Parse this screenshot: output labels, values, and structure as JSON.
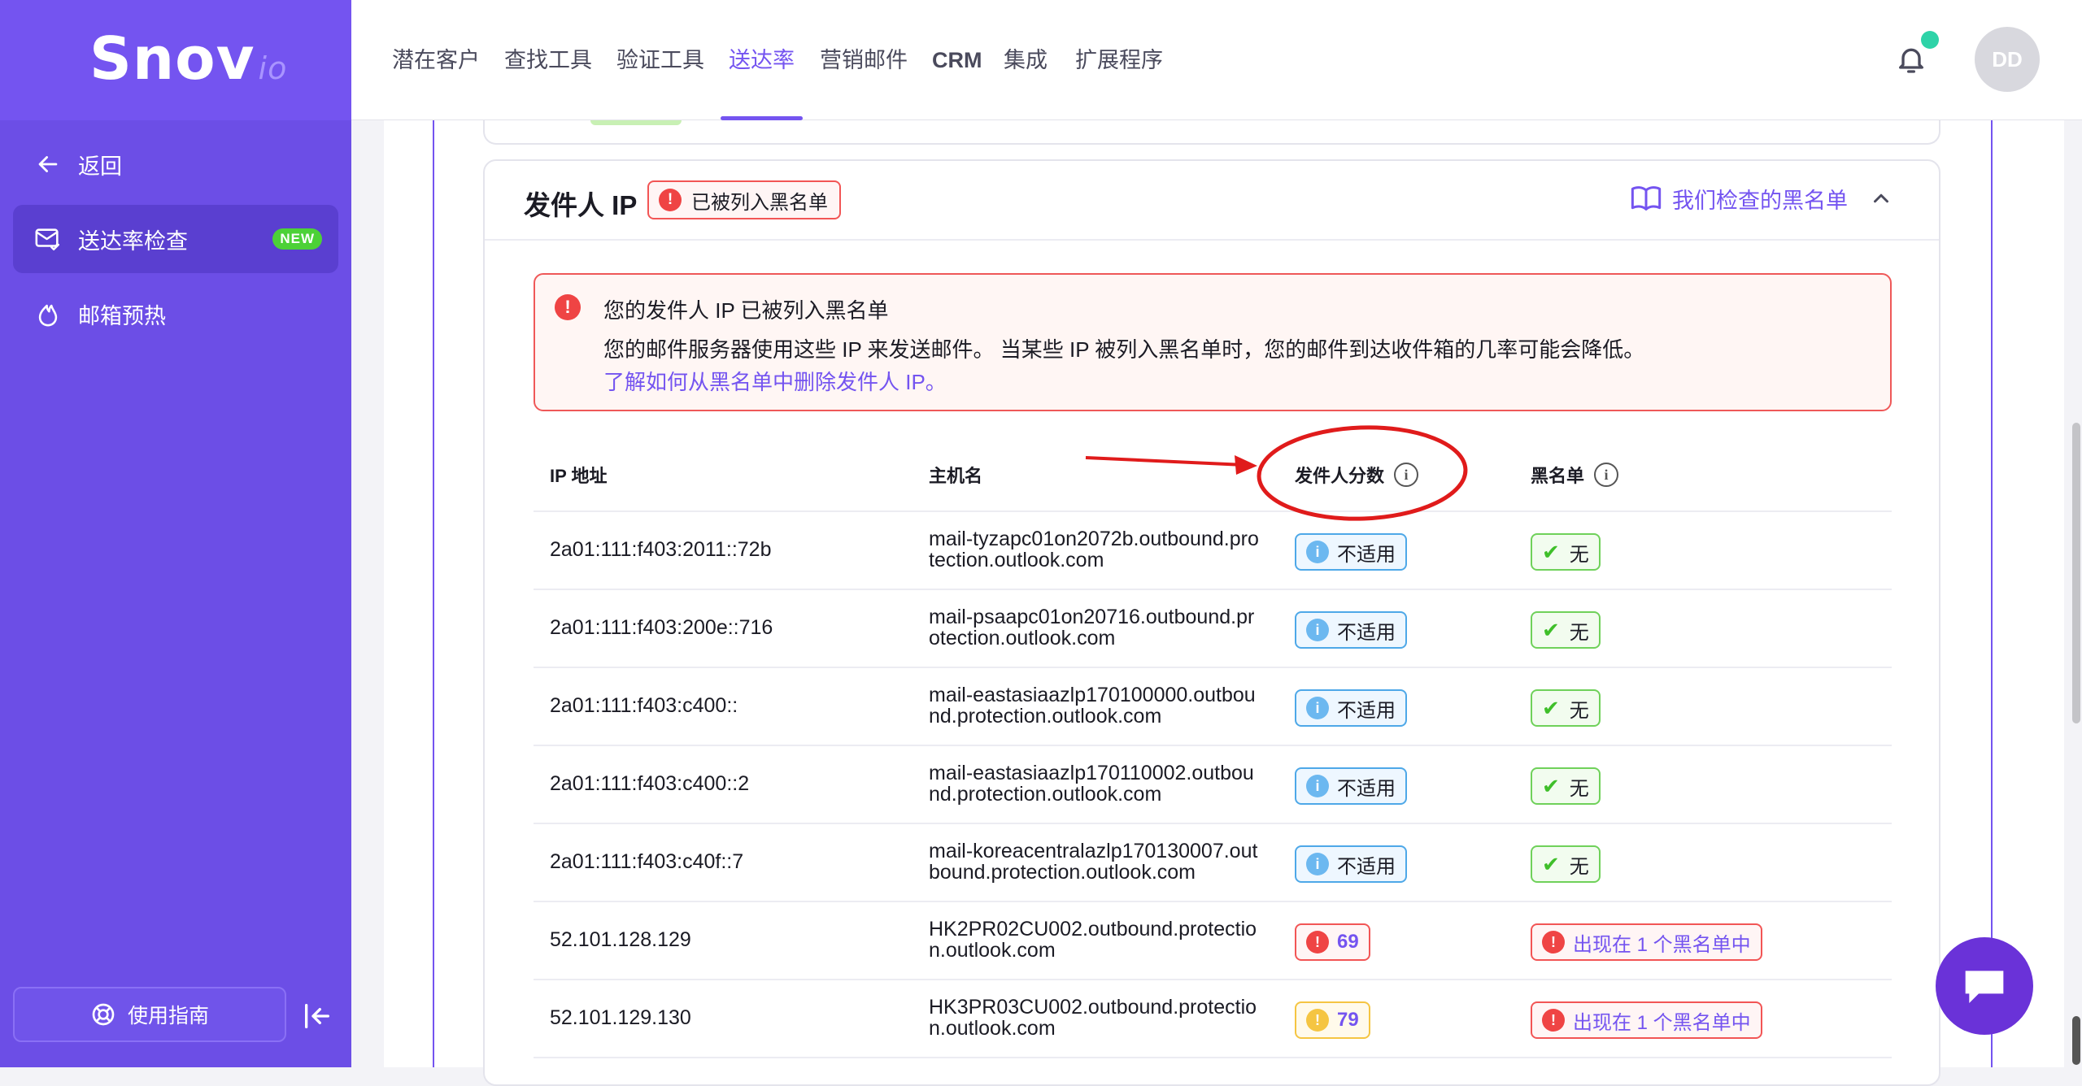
{
  "logo": {
    "main": "Snov",
    "suffix": "io"
  },
  "sidebar": {
    "back_label": "返回",
    "items": [
      {
        "label": "送达率检查",
        "badge": "NEW",
        "active": true
      },
      {
        "label": "邮箱预热",
        "active": false
      }
    ],
    "guide_label": "使用指南"
  },
  "topnav": {
    "items": [
      "潜在客户",
      "查找工具",
      "验证工具",
      "送达率",
      "营销邮件",
      "CRM",
      "集成",
      "扩展程序"
    ],
    "active_index": 3,
    "avatar_initials": "DD"
  },
  "card": {
    "title": "发件人 IP",
    "status_badge": "已被列入黑名单",
    "blacklists_link": "我们检查的黑名单",
    "alert": {
      "title": "您的发件人 IP 已被列入黑名单",
      "description": "您的邮件服务器使用这些 IP 来发送邮件。 当某些 IP 被列入黑名单时，您的邮件到达收件箱的几率可能会降低。",
      "link": "了解如何从黑名单中删除发件人 IP。"
    },
    "table": {
      "headers": {
        "ip": "IP 地址",
        "host": "主机名",
        "score": "发件人分数",
        "blacklist": "黑名单"
      },
      "rows": [
        {
          "ip": "2a01:111:f403:2011::72b",
          "host": "mail-tyzapc01on2072b.outbound.protection.outlook.com",
          "score": "不适用",
          "score_type": "na",
          "blacklist": "无",
          "bl_type": "ok"
        },
        {
          "ip": "2a01:111:f403:200e::716",
          "host": "mail-psaapc01on20716.outbound.protection.outlook.com",
          "score": "不适用",
          "score_type": "na",
          "blacklist": "无",
          "bl_type": "ok"
        },
        {
          "ip": "2a01:111:f403:c400::",
          "host": "mail-eastasiaazlp170100000.outbound.protection.outlook.com",
          "score": "不适用",
          "score_type": "na",
          "blacklist": "无",
          "bl_type": "ok"
        },
        {
          "ip": "2a01:111:f403:c400::2",
          "host": "mail-eastasiaazlp170110002.outbound.protection.outlook.com",
          "score": "不适用",
          "score_type": "na",
          "blacklist": "无",
          "bl_type": "ok"
        },
        {
          "ip": "2a01:111:f403:c40f::7",
          "host": "mail-koreacentralazlp170130007.outbound.protection.outlook.com",
          "score": "不适用",
          "score_type": "na",
          "blacklist": "无",
          "bl_type": "ok"
        },
        {
          "ip": "52.101.128.129",
          "host": "HK2PR02CU002.outbound.protection.outlook.com",
          "score": "69",
          "score_type": "red",
          "blacklist": "出现在 1 个黑名单中",
          "bl_type": "bad"
        },
        {
          "ip": "52.101.129.130",
          "host": "HK3PR03CU002.outbound.protection.outlook.com",
          "score": "79",
          "score_type": "yellow",
          "blacklist": "出现在 1 个黑名单中",
          "bl_type": "bad"
        }
      ]
    }
  },
  "colors": {
    "brand": "#7454f0",
    "danger": "#ef4444",
    "success": "#3fbf2a",
    "info": "#6cb8f0",
    "warning": "#f5c542"
  }
}
